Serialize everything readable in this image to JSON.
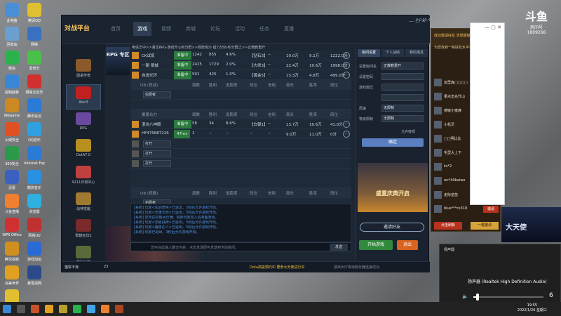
{
  "desktop": {
    "icons": [
      "此电脑",
      "腾讯QQ",
      "回收站",
      "网络",
      "微信",
      "爱奇艺",
      "控制面板",
      "网易云音乐",
      "WeGame",
      "腾讯会议",
      "火绒安全",
      "QQ音乐",
      "360安全",
      "Internet Explorer",
      "迅雷",
      "酷狗音乐",
      "斗鱼直播",
      "浏览器",
      "WPS Office",
      "网易UU",
      "腾讯视频",
      "游戏加加",
      "完美世界",
      "暴雪战网",
      "YY语音"
    ]
  },
  "app": {
    "logo": "对战平台",
    "version": "2.0.25.41",
    "nav": [
      "首页",
      "游戏",
      "视频",
      "商城",
      "论坛",
      "活动",
      "任务",
      "直播"
    ],
    "active_nav": "游戏",
    "sidebar": [
      {
        "label": "圆桌传奇"
      },
      {
        "label": "War3"
      },
      {
        "label": "RPG"
      },
      {
        "label": "DotA7.0"
      },
      {
        "label": "9211日常中心"
      },
      {
        "label": "战神觉醒"
      },
      {
        "label": "群雄征伐2"
      },
      {
        "label": "梦回三国"
      }
    ],
    "banner": "RPG\n专区",
    "breadcrumb": "电信华中>>湖北RPG-游戏开心积分群>>经典荒沙 猎刀S58-积分群之>>正教教重开",
    "rooms_top": [
      {
        "name": "CK试炼",
        "status": "准备中",
        "c1": "1242",
        "c2": "855",
        "c3": "4.6%",
        "c4": "【钻石3】",
        "c5": "--",
        "c6": "10.0万",
        "c7": "9.1万",
        "c8": "1222.0分"
      },
      {
        "name": "一路 猜城",
        "status": "准备中",
        "c1": "2425",
        "c2": "1729",
        "c3": "2.0%",
        "c4": "【大师3】",
        "c5": "--",
        "c6": "22.4万",
        "c7": "10.6万",
        "c8": "1998.0分"
      },
      {
        "name": "自选光环",
        "status": "准备中",
        "c1": "501",
        "c2": "425",
        "c3": "1.0%",
        "c4": "【黄金5】",
        "c5": "--",
        "c6": "13.3万",
        "c7": "4.8万",
        "c8": "499.0分"
      }
    ],
    "headers_a": [
      "OB (观战)",
      "局数",
      "胜利",
      "逃跑率",
      "段位",
      "信用",
      "局长",
      "胜率",
      "段位"
    ],
    "ob_select": "伯爵者",
    "group_label": "屠魔合力",
    "rooms_mid": [
      {
        "name": "混沌八神殿",
        "status": "准备中",
        "c1": "58",
        "c2": "34",
        "c3": "8.6%",
        "c4": "【白银1】",
        "c5": "--",
        "c6": "13.7万",
        "c7": "10.6万",
        "c8": "41.0分"
      },
      {
        "name": "HF475887226",
        "status": "47ms",
        "c1": "1",
        "c2": "--",
        "c3": "--",
        "c4": "--",
        "c5": "--",
        "c6": "9.0万",
        "c7": "11.0万",
        "c8": "0分"
      }
    ],
    "slot_selects": [
      "打开",
      "打开",
      "打开"
    ],
    "headers_b": [
      "OB (观察)",
      "局数",
      "胜利",
      "逃跑率",
      "段位",
      "信用",
      "局长",
      "胜率",
      "段位"
    ],
    "ob_select2": "伯爵者",
    "chat_lines": [
      "[系统] 玩家<仙剑奇侠>已退出，3秒后允许游戏开局。",
      "[系统] 玩家<天蓬元帅>已退出，3秒后允许游戏开局。",
      "[系统] 您所在的房间已满，有新玩家加入请准备游戏。",
      "[系统] 玩家<无敌战神>已退出，3秒后允许游戏开局。",
      "[系统] 玩家<魔兽达人>已退出，3秒后允许游戏开局。",
      "[系统] 玩家已退出，3秒后允许游戏开局。"
    ],
    "chat_placeholder": "您可在此输入聊天内容，点击发送即可发送到当前房间。",
    "send_label": "发送",
    "ad_text": "盼望春来",
    "right_tabs": [
      "房间设置",
      "个人战绩",
      "我的道具"
    ],
    "settings": [
      {
        "label": "设置房间名",
        "value": "正教教重开"
      },
      {
        "label": "设置密码",
        "value": ""
      },
      {
        "label": "游戏模式",
        "value": ""
      },
      {
        "label": "",
        "value": ""
      },
      {
        "label": "局速",
        "value": "无限制"
      },
      {
        "label": "等级限制",
        "value": "无限制"
      }
    ],
    "allow_watch": "允许旁观",
    "confirm_label": "确定",
    "promo_text": "盛夏庆典开启",
    "invite_label": "邀请好友",
    "start_label": "开始游戏",
    "exit_label": "退出",
    "status_user": "猫饼不滑",
    "status_level": "23",
    "status_notice": "Dota高能预约中 要参大天使进行中",
    "status_notice2": "游戏大厅等待服务器连接成功"
  },
  "friends": {
    "title": "成功邀请好友 享受超级福利",
    "hint": "为您找到一些好友水平相近的朋友:",
    "items": [
      "加里森□□□□",
      "果点击先升山",
      "黄敏小蜜蜂",
      "小机灵",
      "□□明比比",
      "毛里大上下",
      "ks*2",
      "wc*40baiwo",
      "走际苗苗",
      "blue***cs318"
    ],
    "invite_label": "邀请",
    "refresh_label": "点击刷新",
    "oneclick_label": "一键邀请"
  },
  "stream": {
    "logo": "斗鱼",
    "subtitle": "房间号",
    "room_no": "1809266",
    "ad": "大天使"
  },
  "volume": {
    "title": "扬声器",
    "device": "扬声器 (Realtek High Definition Audio)",
    "level": 6
  },
  "taskbar": {
    "time": "19:55",
    "date": "2022/1/26 星期三"
  }
}
